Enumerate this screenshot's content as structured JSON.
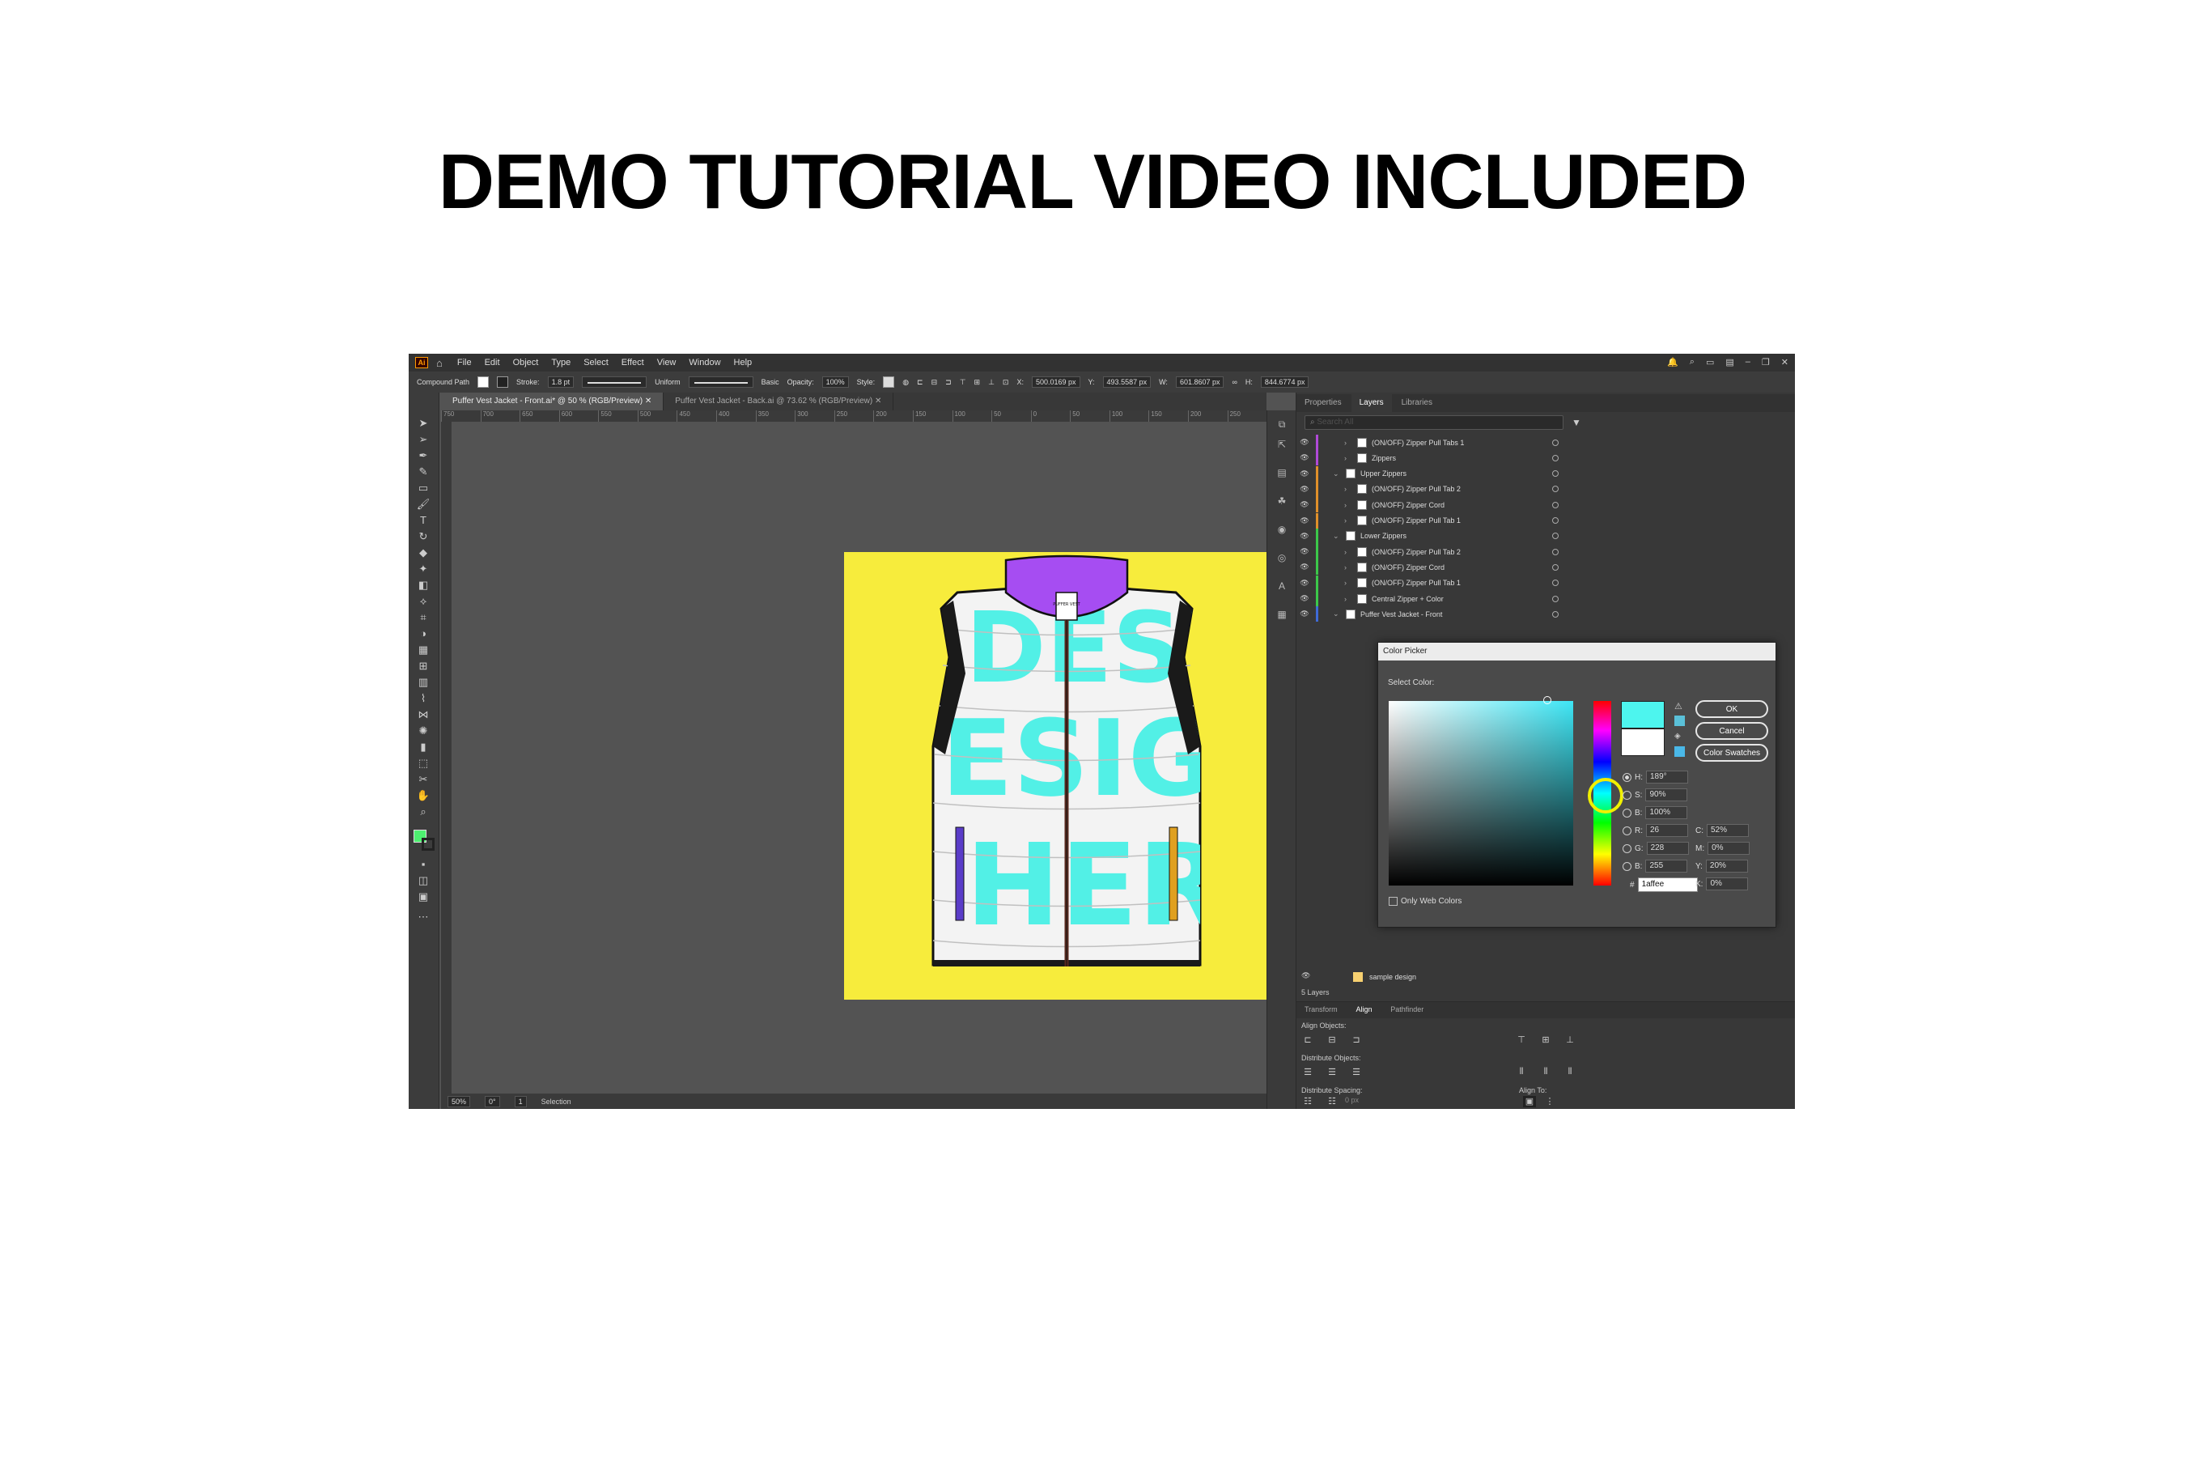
{
  "headline": "DEMO TUTORIAL VIDEO INCLUDED",
  "app": {
    "logo": "Ai",
    "menu": [
      "File",
      "Edit",
      "Object",
      "Type",
      "Select",
      "Effect",
      "View",
      "Window",
      "Help"
    ]
  },
  "control_bar": {
    "selection_type": "Compound Path",
    "stroke_label": "Stroke:",
    "stroke_value": "1.8 pt",
    "profile": "Uniform",
    "brush": "Basic",
    "opacity_label": "Opacity:",
    "opacity_value": "100%",
    "style_label": "Style:",
    "x_label": "X:",
    "x_value": "500.0169 px",
    "y_label": "Y:",
    "y_value": "493.5587 px",
    "w_label": "W:",
    "w_value": "601.8607 px",
    "h_label": "H:",
    "h_value": "844.6774 px"
  },
  "doc_tabs": [
    {
      "label": "Puffer Vest Jacket - Front.ai* @ 50 % (RGB/Preview)",
      "active": true
    },
    {
      "label": "Puffer Vest Jacket - Back.ai @ 73.62 % (RGB/Preview)",
      "active": false
    }
  ],
  "ruler_ticks": [
    "750",
    "700",
    "650",
    "600",
    "550",
    "500",
    "450",
    "400",
    "350",
    "300",
    "250",
    "200",
    "150",
    "100",
    "50",
    "0",
    "50",
    "100",
    "150",
    "200",
    "250"
  ],
  "status_bar": {
    "zoom": "50%",
    "rotation": "0°",
    "artboard": "1",
    "tool": "Selection"
  },
  "panel": {
    "tabs": [
      "Properties",
      "Layers",
      "Libraries"
    ],
    "active_tab": "Layers",
    "search_placeholder": "Search All",
    "layers": [
      {
        "label": "(ON/OFF) Zipper Pull Tabs 1",
        "indent": 2,
        "color": "#b04ad8"
      },
      {
        "label": "Zippers",
        "indent": 2,
        "color": "#b04ad8"
      },
      {
        "label": "Upper Zippers",
        "indent": 1,
        "color": "#e0902a"
      },
      {
        "label": "(ON/OFF) Zipper Pull Tab 2",
        "indent": 2,
        "color": "#e0902a"
      },
      {
        "label": "(ON/OFF) Zipper Cord",
        "indent": 2,
        "color": "#e0902a"
      },
      {
        "label": "(ON/OFF) Zipper Pull Tab 1",
        "indent": 2,
        "color": "#e0902a"
      },
      {
        "label": "Lower Zippers",
        "indent": 1,
        "color": "#3cc84a"
      },
      {
        "label": "(ON/OFF) Zipper Pull Tab 2",
        "indent": 2,
        "color": "#3cc84a"
      },
      {
        "label": "(ON/OFF) Zipper Cord",
        "indent": 2,
        "color": "#3cc84a"
      },
      {
        "label": "(ON/OFF) Zipper Pull Tab 1",
        "indent": 2,
        "color": "#3cc84a"
      },
      {
        "label": "Central Zipper + Color",
        "indent": 2,
        "color": "#3cc84a"
      },
      {
        "label": "Puffer Vest Jacket - Front",
        "indent": 1,
        "color": "#3f6bd8"
      }
    ],
    "bottom_layer": "sample design",
    "layers_count": "5 Layers",
    "bottom_tabs": [
      "Transform",
      "Align",
      "Pathfinder"
    ],
    "bottom_active": "Align",
    "align_objects": "Align Objects:",
    "distribute_objects": "Distribute Objects:",
    "distribute_spacing": "Distribute Spacing:",
    "align_to": "Align To:",
    "spacing_value": "0 px"
  },
  "color_picker": {
    "title": "Color Picker",
    "select_color": "Select Color:",
    "ok": "OK",
    "cancel": "Cancel",
    "swatches": "Color Swatches",
    "h_label": "H:",
    "h_value": "189°",
    "s_label": "S:",
    "s_value": "90%",
    "b_label": "B:",
    "b_value": "100%",
    "r_label": "R:",
    "r_value": "26",
    "g_label": "G:",
    "g_value": "228",
    "bl_label": "B:",
    "bl_value": "255",
    "c_label": "C:",
    "c_value": "52%",
    "m_label": "M:",
    "m_value": "0%",
    "y_label": "Y:",
    "y_value": "20%",
    "k_label": "K:",
    "k_value": "0%",
    "hash": "#",
    "hex_value": "1affee",
    "web_only": "Only Web Colors",
    "new_color": "#4df5ee",
    "old_color": "#ffffff"
  },
  "vest": {
    "label": "PUFFER VEST",
    "print_text": [
      "DESIG",
      "ESIG",
      "HER"
    ],
    "body_color": "#f3f3f3",
    "print_color": "#52f0e6",
    "collar_color": "#a64df2",
    "artboard_color": "#f7ec3c",
    "pocket_left": "#5a3cc8",
    "pocket_right": "#e0a020"
  }
}
